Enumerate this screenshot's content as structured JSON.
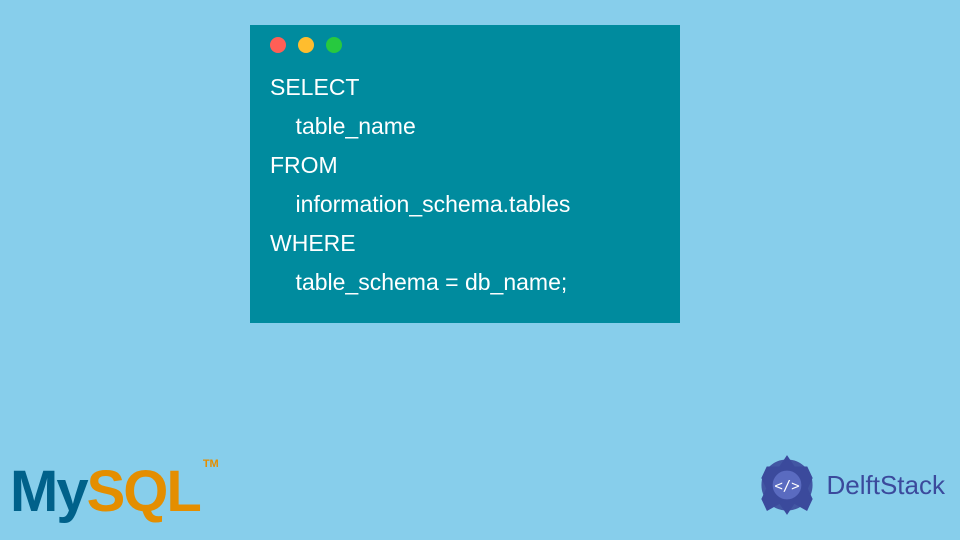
{
  "code": {
    "lines": [
      "SELECT",
      "    table_name",
      "FROM",
      "    information_schema.tables",
      "WHERE",
      "    table_schema = db_name;"
    ]
  },
  "logos": {
    "mysql": {
      "my": "My",
      "sql": "SQL",
      "tm": "TM"
    },
    "delftstack": {
      "text": "DelftStack"
    }
  }
}
